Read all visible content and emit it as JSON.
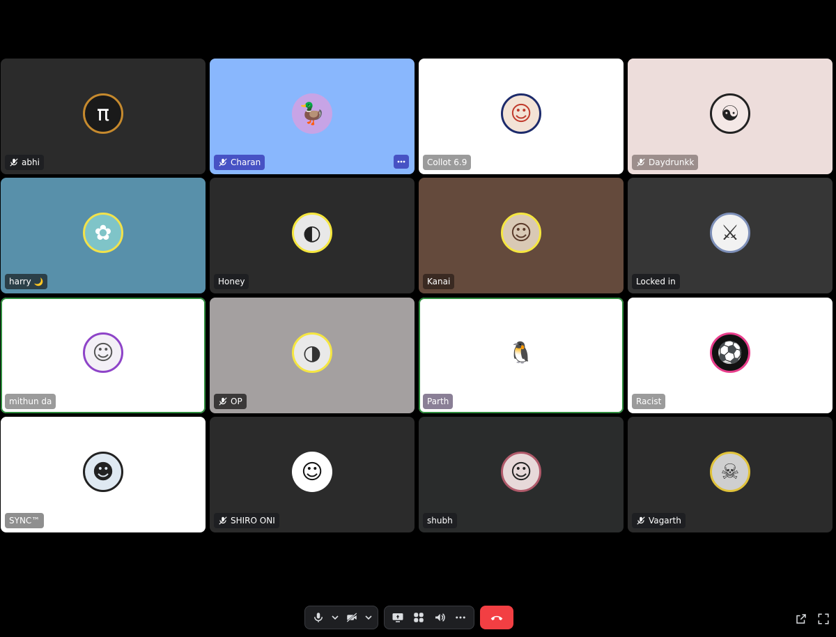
{
  "colors": {
    "background": "#000000",
    "control_bar": "#1e1f22",
    "hangup": "#f23f43",
    "speaking_ring": "#2d8c3c",
    "more_button": "#4752c4"
  },
  "participants": [
    {
      "name": "abhi",
      "muted": true,
      "bg": "#2b2b2b",
      "avatar_icon": "pi-symbol-icon",
      "avatar_glyph": "π",
      "avatar_bg": "#1a1a1a",
      "avatar_fg": "#ffffff",
      "avatar_ring": "#c68a2e",
      "label_bg": "#1e1f22",
      "label_fg": "#ffffff"
    },
    {
      "name": "Charan",
      "muted": true,
      "bg": "#89b7fd",
      "avatar_icon": "duck-avatar-icon",
      "avatar_glyph": "🦆",
      "avatar_bg": "#c7a4e6",
      "avatar_fg": "#ffe04d",
      "avatar_ring": "",
      "label_bg": "#4752c4",
      "label_fg": "#ffffff",
      "has_more": true
    },
    {
      "name": "Collot 6.9",
      "muted": false,
      "bg": "#ffffff",
      "avatar_icon": "person-headphones-icon",
      "avatar_glyph": "☺",
      "avatar_bg": "#f3e3d6",
      "avatar_fg": "#c0392b",
      "avatar_ring": "#1d2b6b",
      "label_bg": "#9b9b9b",
      "label_fg": "#ffffff"
    },
    {
      "name": "Daydrunkk",
      "muted": true,
      "bg": "#eddddb",
      "avatar_icon": "anime-avatar-icon",
      "avatar_glyph": "☯",
      "avatar_bg": "#f4e8e6",
      "avatar_fg": "#222222",
      "avatar_ring": "#222222",
      "label_bg": "#9c8e8c",
      "label_fg": "#ffffff"
    },
    {
      "name": "harry",
      "muted": false,
      "bg": "#5890aa",
      "avatar_icon": "fairy-avatar-icon",
      "avatar_glyph": "✿",
      "avatar_bg": "#7fc4c8",
      "avatar_fg": "#ffffff",
      "avatar_ring": "#f2e24a",
      "label_bg": "#2b3f48",
      "label_fg": "#ffffff",
      "emoji": "🌙"
    },
    {
      "name": "Honey",
      "muted": false,
      "bg": "#2b2b2b",
      "avatar_icon": "bw-anime-avatar-icon",
      "avatar_glyph": "◐",
      "avatar_bg": "#e8e8e8",
      "avatar_fg": "#222222",
      "avatar_ring": "#f5e640",
      "label_bg": "#1e1f22",
      "label_fg": "#ffffff"
    },
    {
      "name": "Kanai",
      "muted": false,
      "bg": "#644a3c",
      "avatar_icon": "person-photo-icon",
      "avatar_glyph": "☺",
      "avatar_bg": "#d9c9b5",
      "avatar_fg": "#5a3a2a",
      "avatar_ring": "#f5e640",
      "label_bg": "#3a2a22",
      "label_fg": "#ffffff"
    },
    {
      "name": "Locked in",
      "muted": false,
      "bg": "#363636",
      "avatar_icon": "knight-avatar-icon",
      "avatar_glyph": "⚔",
      "avatar_bg": "#f2f2f2",
      "avatar_fg": "#333333",
      "avatar_ring": "#7d8fb8",
      "label_bg": "#1e1f22",
      "label_fg": "#ffffff"
    },
    {
      "name": "mithun da",
      "muted": false,
      "bg": "#ffffff",
      "avatar_icon": "anime-boy-avatar-icon",
      "avatar_glyph": "☺",
      "avatar_bg": "#f3f0f6",
      "avatar_fg": "#555555",
      "avatar_ring": "#8e44c8",
      "label_bg": "#9b9b9b",
      "label_fg": "#ffffff",
      "speaking": true
    },
    {
      "name": "OP",
      "muted": true,
      "bg": "#a4a0a0",
      "avatar_icon": "anime-hat-avatar-icon",
      "avatar_glyph": "◑",
      "avatar_bg": "#e9e9e9",
      "avatar_fg": "#333333",
      "avatar_ring": "#f5e640",
      "label_bg": "#3a3838",
      "label_fg": "#ffffff"
    },
    {
      "name": "Parth",
      "muted": false,
      "bg": "#ffffff",
      "avatar_icon": "penguin-avatar-icon",
      "avatar_glyph": "🐧",
      "avatar_bg": "#ffffff",
      "avatar_fg": "#3d8fc7",
      "avatar_ring": "",
      "label_bg": "#8a7f96",
      "label_fg": "#ffffff",
      "speaking": true
    },
    {
      "name": "Racist",
      "muted": false,
      "bg": "#ffffff",
      "avatar_icon": "crest-avatar-icon",
      "avatar_glyph": "⚽",
      "avatar_bg": "#111111",
      "avatar_fg": "#e83e8c",
      "avatar_ring": "#e83e8c",
      "label_bg": "#9b9b9b",
      "label_fg": "#ffffff"
    },
    {
      "name": "SYNC™",
      "muted": false,
      "bg": "#ffffff",
      "avatar_icon": "anime-boy-avatar-icon",
      "avatar_glyph": "☻",
      "avatar_bg": "#dfe9f2",
      "avatar_fg": "#222222",
      "avatar_ring": "#222222",
      "label_bg": "#8f8f8f",
      "label_fg": "#ffffff"
    },
    {
      "name": "SHIRO ONI",
      "muted": true,
      "bg": "#2b2b2b",
      "avatar_icon": "manga-face-avatar-icon",
      "avatar_glyph": "☺",
      "avatar_bg": "#ffffff",
      "avatar_fg": "#111111",
      "avatar_ring": "",
      "label_bg": "#1e1f22",
      "label_fg": "#ffffff"
    },
    {
      "name": "shubh",
      "muted": false,
      "bg": "#2a2c2c",
      "avatar_icon": "anime-girl-avatar-icon",
      "avatar_glyph": "☺",
      "avatar_bg": "#e7d9d9",
      "avatar_fg": "#222222",
      "avatar_ring": "#b05a6a",
      "label_bg": "#1e1f22",
      "label_fg": "#ffffff"
    },
    {
      "name": "Vagarth",
      "muted": true,
      "bg": "#2b2b2b",
      "avatar_icon": "demon-avatar-icon",
      "avatar_glyph": "☠",
      "avatar_bg": "#cfcfcf",
      "avatar_fg": "#333333",
      "avatar_ring": "#e0c23a",
      "label_bg": "#1e1f22",
      "label_fg": "#ffffff"
    }
  ],
  "controls": {
    "microphone": "microphone-icon",
    "mic_options": "chevron-down-icon",
    "camera": "camera-off-icon",
    "camera_options": "chevron-down-icon",
    "screen_share": "screen-share-icon",
    "activities": "activities-icon",
    "soundboard": "soundboard-icon",
    "more": "more-options-icon",
    "disconnect": "hang-up-icon",
    "popout": "popout-icon",
    "fullscreen": "fullscreen-icon"
  }
}
